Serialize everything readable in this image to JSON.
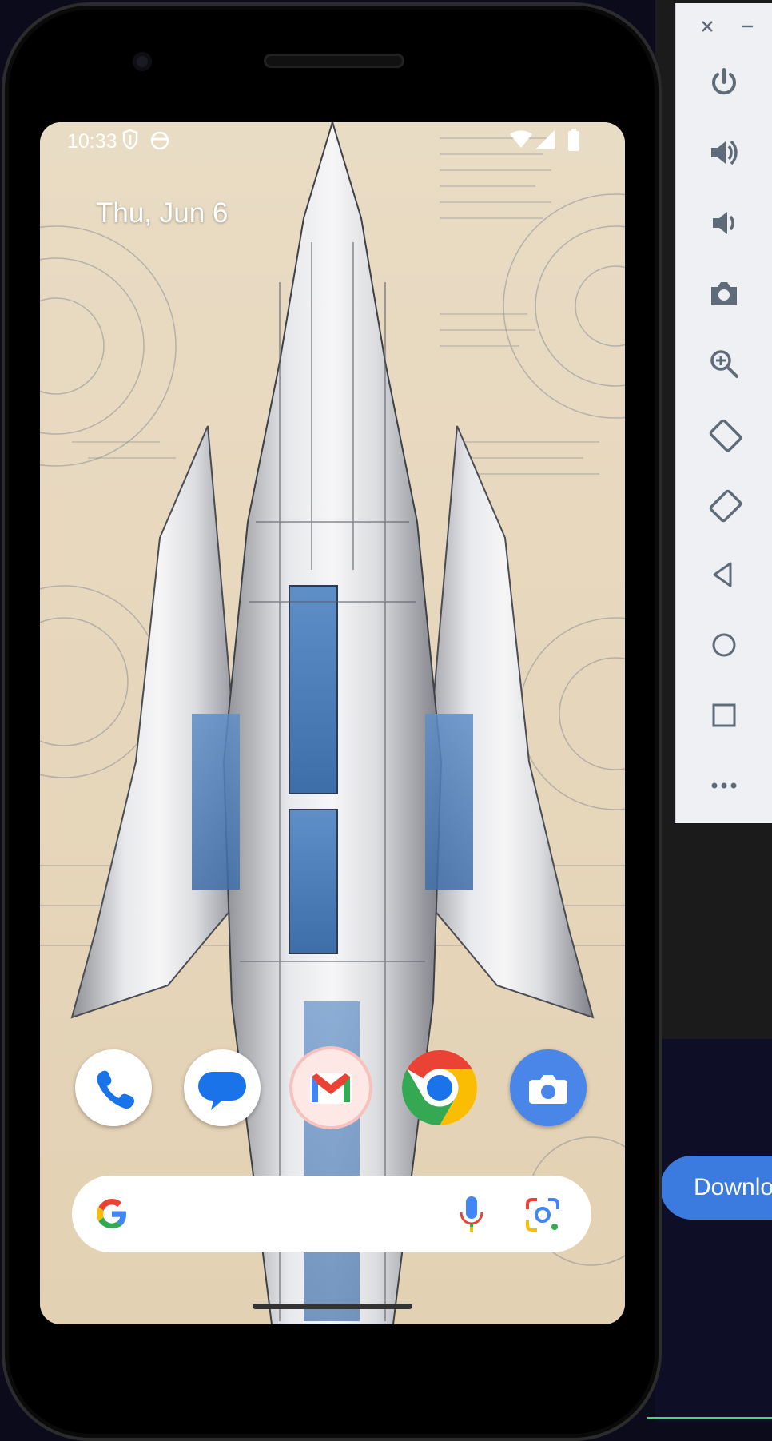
{
  "status_bar": {
    "time": "10:33"
  },
  "home": {
    "date": "Thu, Jun 6",
    "dock_apps": [
      {
        "name": "Phone",
        "icon": "phone-icon"
      },
      {
        "name": "Messages",
        "icon": "messages-icon"
      },
      {
        "name": "Gmail",
        "icon": "gmail-icon"
      },
      {
        "name": "Chrome",
        "icon": "chrome-icon"
      },
      {
        "name": "Camera",
        "icon": "camera-icon"
      }
    ],
    "search": {
      "google_icon": "google-g-icon",
      "mic_icon": "mic-icon",
      "lens_icon": "lens-icon"
    }
  },
  "emulator_toolbar": {
    "buttons": [
      "power-icon",
      "volume-up-icon",
      "volume-down-icon",
      "screenshot-icon",
      "zoom-icon",
      "rotate-left-icon",
      "rotate-right-icon",
      "back-icon",
      "home-icon",
      "overview-icon",
      "more-icon"
    ]
  },
  "host_window": {
    "download_label": "Downlo"
  },
  "colors": {
    "wallpaper": "#e6d6bc",
    "google_blue": "#4285f4",
    "google_red": "#ea4335",
    "google_yellow": "#fbbc04",
    "google_green": "#34a853",
    "toolbar_bg": "#eef0f3",
    "toolbar_icon": "#5f6b78",
    "download_button": "#3b7be0"
  }
}
